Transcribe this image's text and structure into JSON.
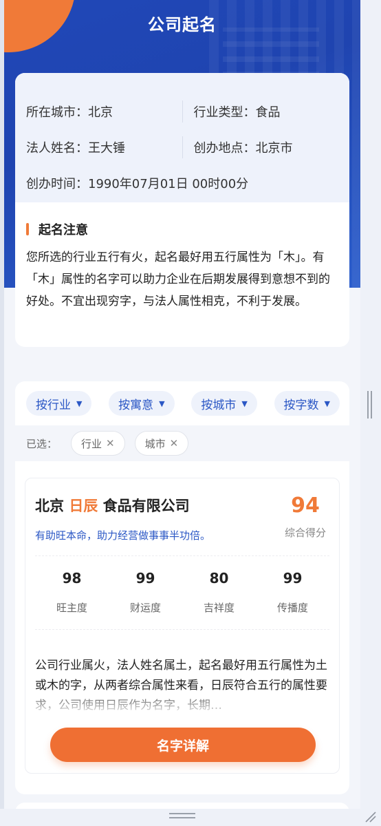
{
  "header": {
    "title": "公司起名"
  },
  "info": {
    "city": "所在城市：北京",
    "industry": "行业类型：食品",
    "legal_name": "法人姓名：王大锤",
    "location": "创办地点：北京市",
    "founded": "创办时间：1990年07月01日 00时00分"
  },
  "tip": {
    "heading": "起名注意",
    "text": "您所选的行业五行有火，起名最好用五行属性为「木」。有「木」属性的名字可以助力企业在后期发展得到意想不到的好处。不宜出现穷字，与法人属性相克，不利于发展。"
  },
  "filters": [
    {
      "label": "按行业"
    },
    {
      "label": "按寓意"
    },
    {
      "label": "按城市"
    },
    {
      "label": "按字数"
    }
  ],
  "selected": {
    "label": "已选：",
    "chips": [
      {
        "label": "行业"
      },
      {
        "label": "城市"
      }
    ]
  },
  "result": {
    "prefix": "北京",
    "highlight": "日辰",
    "suffix": "食品有限公司",
    "subtitle": "有助旺本命，助力经营做事事半功倍。",
    "score": "94",
    "score_label": "综合得分",
    "metrics": [
      {
        "value": "98",
        "label": "旺主度"
      },
      {
        "value": "99",
        "label": "财运度"
      },
      {
        "value": "80",
        "label": "吉祥度"
      },
      {
        "value": "99",
        "label": "传播度"
      }
    ],
    "description": "公司行业属火，法人姓名属土，起名最好用五行属性为土或木的字，从两者综合属性来看，日辰符合五行的属性要求，公司使用日辰作为名字，长期…",
    "detail_button": "名字详解"
  },
  "colors": {
    "brand_blue": "#2048b8",
    "accent_orange": "#ef6f33"
  }
}
